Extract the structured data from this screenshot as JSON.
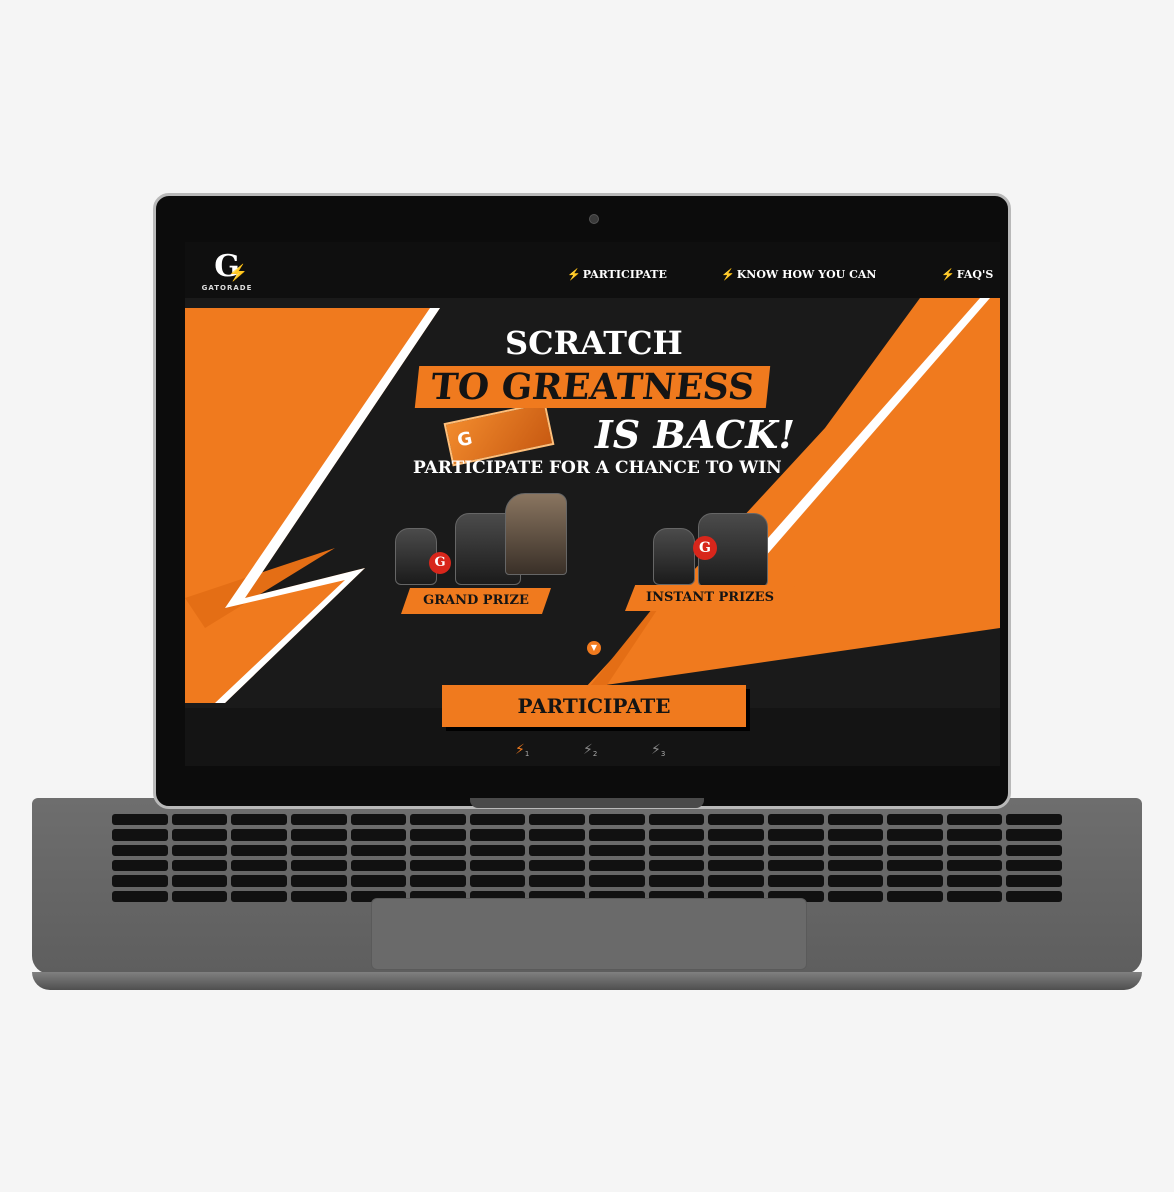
{
  "brand": {
    "logo_text": "GATORADE",
    "logo_mark": "G",
    "accent": "#f07a1e"
  },
  "nav": [
    {
      "label": "PARTICIPATE"
    },
    {
      "label": "KNOW HOW YOU CAN"
    },
    {
      "label": "FAQ'S"
    }
  ],
  "hero": {
    "title_line1": "SCRATCH",
    "title_line2": "TO GREATNESS",
    "title_line3": "IS BACK!",
    "subtitle": "PARTICIPATE FOR A CHANCE TO WIN"
  },
  "prizes": {
    "grand_label": "GRAND PRIZE",
    "instant_label": "INSTANT PRIZES"
  },
  "cta": {
    "label": "PARTICIPATE"
  },
  "steps": [
    {
      "number": "1",
      "active": true
    },
    {
      "number": "2",
      "active": false
    },
    {
      "number": "3",
      "active": false
    }
  ],
  "colors": {
    "orange": "#f07a1e",
    "dark": "#141414",
    "laptop_body": "#6a6a6a"
  }
}
